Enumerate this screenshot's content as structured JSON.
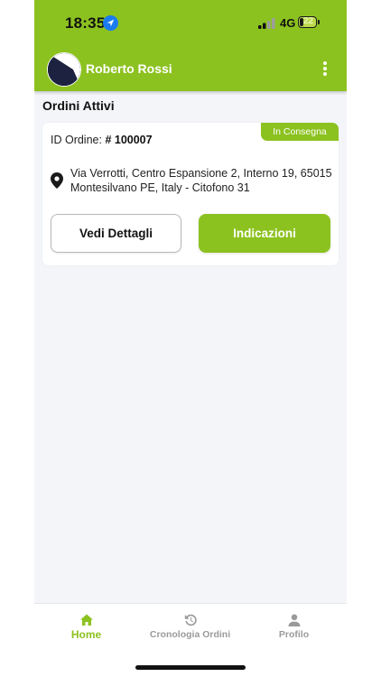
{
  "status_bar": {
    "time": "18:35",
    "network": "4G",
    "battery": "22",
    "battery_level": 0.22
  },
  "header": {
    "user_name": "Roberto Rossi"
  },
  "main": {
    "section_title": "Ordini Attivi",
    "order": {
      "status_badge": "In Consegna",
      "id_label": "ID Ordine:",
      "id_value": "# 100007",
      "address_line1": "Via Verrotti, Centro Espansione 2, Interno 19, 65015",
      "address_line2": "Montesilvano PE, Italy - Citofono 31",
      "details_button": "Vedi Dettagli",
      "directions_button": "Indicazioni"
    }
  },
  "bottom_nav": {
    "items": [
      {
        "label": "Home",
        "icon": "home-icon"
      },
      {
        "label": "Cronologia Ordini",
        "icon": "history-icon"
      },
      {
        "label": "Profilo",
        "icon": "person-icon"
      }
    ]
  },
  "colors": {
    "brand_green": "#8cc220",
    "background": "#f3f5f8",
    "inactive_nav": "#9a9a9a"
  }
}
